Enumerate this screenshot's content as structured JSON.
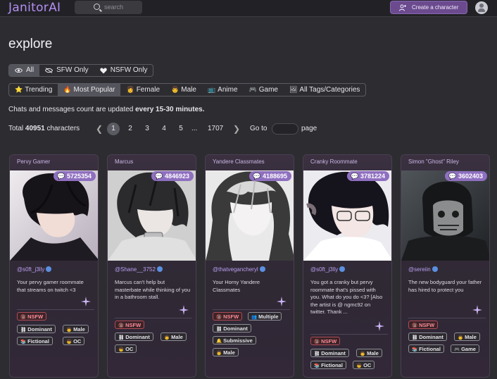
{
  "header": {
    "logo": "JanitorAI",
    "search_placeholder": "search",
    "create_label": "Create a character"
  },
  "page_title": "explore",
  "filter_segment": [
    {
      "label": "All",
      "icon": "eye-icon",
      "active": true
    },
    {
      "label": "SFW Only",
      "icon": "eye-slash-icon",
      "active": false
    },
    {
      "label": "NSFW Only",
      "icon": "heart-icon",
      "active": false
    }
  ],
  "categories": [
    {
      "label": "Trending",
      "emoji": "⭐",
      "active": false
    },
    {
      "label": "Most Popular",
      "emoji": "🔥",
      "active": true
    },
    {
      "label": "Female",
      "emoji": "👩",
      "active": false
    },
    {
      "label": "Male",
      "emoji": "👨",
      "active": false
    },
    {
      "label": "Anime",
      "emoji": "📺",
      "active": false
    },
    {
      "label": "Game",
      "emoji": "🎮",
      "active": false
    },
    {
      "label": "All Tags/Categories",
      "emoji": "🖼",
      "active": false
    }
  ],
  "notice": {
    "prefix": "Chats and messages count are updated ",
    "emphasis": "every 15-30 minutes."
  },
  "pager": {
    "total_prefix": "Total ",
    "total_count": "40951",
    "total_suffix": " characters",
    "pages": [
      "1",
      "2",
      "3",
      "4",
      "5"
    ],
    "ellipsis": "...",
    "last_page": "1707",
    "goto_label": "Go to",
    "page_label": "page",
    "prev_glyph": "❮",
    "next_glyph": "❯"
  },
  "cards": [
    {
      "title": "Pervy Gamer",
      "count": "5725354",
      "creator": "@s0ft_j3lly",
      "description": "Your pervy gamer roommate that streams on twitch <3",
      "tags": [
        "NSFW",
        "Dominant",
        "Male",
        "Fictional",
        "OC"
      ]
    },
    {
      "title": "Marcus",
      "count": "4846923",
      "creator": "@Shane__3752",
      "description": "Marcus can't help but masterbate while thinking of you in a bathroom stall.",
      "tags": [
        "NSFW",
        "Dominant",
        "Male",
        "OC"
      ]
    },
    {
      "title": "Yandere Classmates",
      "count": "4188695",
      "creator": "@thatvegancheryl",
      "description": "Your Horny Yandere Classmates",
      "tags": [
        "NSFW",
        "Multiple",
        "Dominant",
        "Submissive",
        "Male"
      ]
    },
    {
      "title": "Cranky Roommate",
      "count": "3781224",
      "creator": "@s0ft_j3lly",
      "description": "You got a cranky but pervy roommate that's pissed with you. What do you do <3? [Also the artist is @ ngmc92 on twitter. Thank ...",
      "tags": [
        "NSFW",
        "Dominant",
        "Male",
        "Fictional",
        "OC"
      ]
    },
    {
      "title": "Simon \"Ghost\" Riley",
      "count": "3602403",
      "creator": "@sereiin",
      "description": "The new bodyguard your father has hired to protect you",
      "tags": [
        "NSFW",
        "Dominant",
        "Male",
        "Fictional",
        "Game"
      ]
    }
  ],
  "colors": {
    "background": "#2d2d31",
    "accent": "#b48ef3",
    "badge": "#8f6fc0",
    "nsfw": "#ff8a96"
  }
}
